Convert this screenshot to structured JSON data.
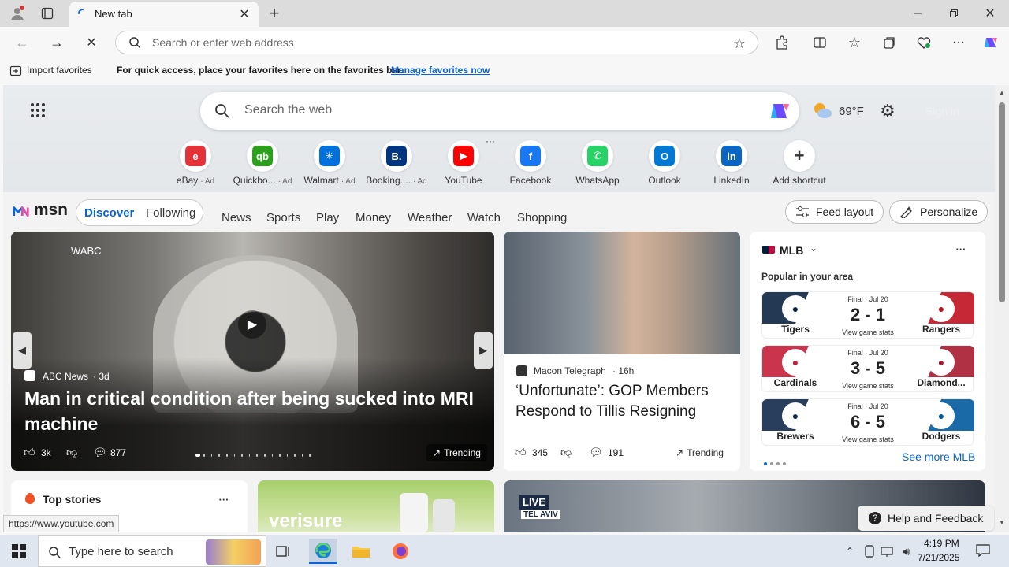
{
  "browser": {
    "tab_title": "New tab",
    "address_placeholder": "Search or enter web address",
    "favorites_import": "Import favorites",
    "favorites_message": "For quick access, place your favorites here on the favorites bar.",
    "favorites_link": "Manage favorites now",
    "status_url": "https://www.youtube.com"
  },
  "newtab": {
    "search_placeholder": "Search the web",
    "temperature": "69°F",
    "sign_in": "Sign in",
    "shortcuts": [
      {
        "name": "eBay",
        "ad": "· Ad",
        "icon": "ebay-icon",
        "color": "#e53238"
      },
      {
        "name": "Quickbo...",
        "ad": "· Ad",
        "icon": "quickbooks-icon",
        "color": "#2ca01c"
      },
      {
        "name": "Walmart",
        "ad": "· Ad",
        "icon": "walmart-icon",
        "color": "#0071dc"
      },
      {
        "name": "Booking....",
        "ad": "· Ad",
        "icon": "booking-icon",
        "color": "#003580"
      },
      {
        "name": "YouTube",
        "ad": "",
        "icon": "youtube-icon",
        "color": "#ff0000"
      },
      {
        "name": "Facebook",
        "ad": "",
        "icon": "facebook-icon",
        "color": "#1877f2"
      },
      {
        "name": "WhatsApp",
        "ad": "",
        "icon": "whatsapp-icon",
        "color": "#25d366"
      },
      {
        "name": "Outlook",
        "ad": "",
        "icon": "outlook-icon",
        "color": "#0078d4"
      },
      {
        "name": "LinkedIn",
        "ad": "",
        "icon": "linkedin-icon",
        "color": "#0a66c2"
      },
      {
        "name": "Add shortcut",
        "ad": "",
        "icon": "plus-icon",
        "color": "#333333"
      }
    ]
  },
  "msn": {
    "brand": "msn",
    "tabs": [
      "Discover",
      "Following"
    ],
    "nav": [
      "News",
      "Sports",
      "Play",
      "Money",
      "Weather",
      "Watch",
      "Shopping"
    ],
    "feed_layout": "Feed layout",
    "personalize": "Personalize"
  },
  "hero_story": {
    "overlay_label": "WABC",
    "source": "ABC News",
    "age": "· 3d",
    "title": "Man in critical condition after being sucked into MRI machine",
    "likes": "3k",
    "comments": "877",
    "trending": "Trending"
  },
  "second_story": {
    "source": "Macon Telegraph",
    "age": "· 16h",
    "title": "‘Unfortunate’: GOP Members Respond to Tillis Resigning",
    "likes": "345",
    "comments": "191",
    "trending": "Trending"
  },
  "mlb": {
    "title": "MLB",
    "subtitle": "Popular in your area",
    "games": [
      {
        "status": "Final · Jul 20",
        "score": "2 - 1",
        "home": "Tigers",
        "away": "Rangers",
        "link": "View game stats",
        "home_color": "#0c2340",
        "away_color": "#c0111f"
      },
      {
        "status": "Final · Jul 20",
        "score": "3 - 5",
        "home": "Cardinals",
        "away": "Diamond...",
        "link": "View game stats",
        "home_color": "#c41e3a",
        "away_color": "#a71930"
      },
      {
        "status": "Final · Jul 20",
        "score": "6 - 5",
        "home": "Brewers",
        "away": "Dodgers",
        "link": "View game stats",
        "home_color": "#12284b",
        "away_color": "#005a9c"
      }
    ],
    "see_more": "See more MLB"
  },
  "bottom": {
    "top_stories": "Top stories",
    "brand_card": "verisure",
    "live_badge": "LIVE",
    "live_location": "TEL AVIV",
    "help": "Help and Feedback"
  },
  "taskbar": {
    "search_placeholder": "Type here to search",
    "time": "4:19 PM",
    "date": "7/21/2025"
  }
}
